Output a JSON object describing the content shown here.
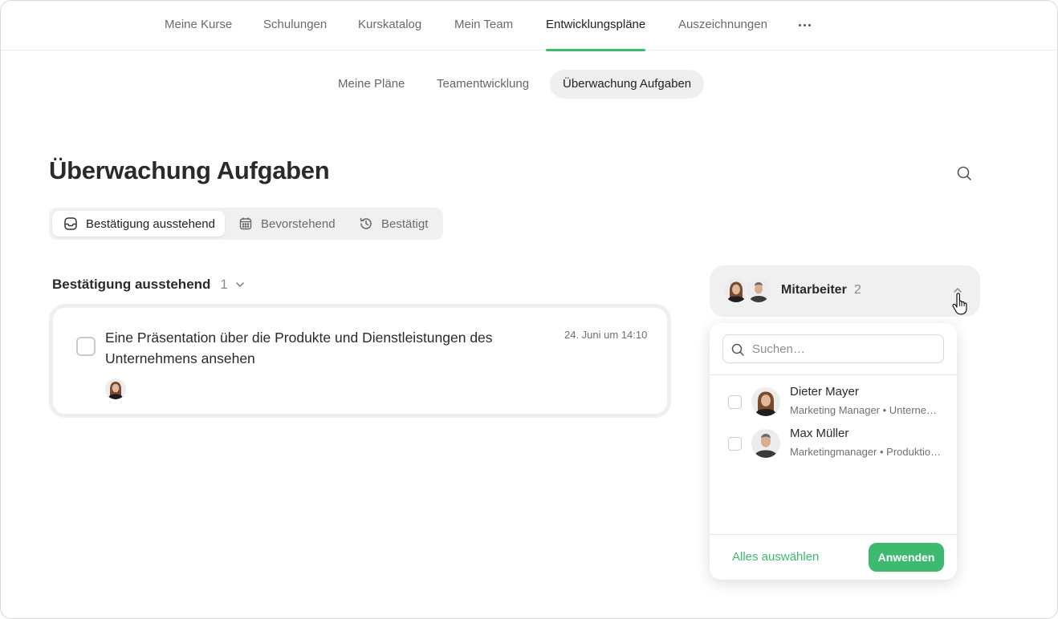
{
  "top_nav": {
    "items": [
      {
        "label": "Meine Kurse"
      },
      {
        "label": "Schulungen"
      },
      {
        "label": "Kurskatalog"
      },
      {
        "label": "Mein Team"
      },
      {
        "label": "Entwicklungspläne",
        "active": true
      },
      {
        "label": "Auszeichnungen"
      }
    ],
    "more_icon": "more-horizontal-icon"
  },
  "sub_nav": {
    "items": [
      {
        "label": "Meine Pläne"
      },
      {
        "label": "Teamentwicklung"
      },
      {
        "label": "Überwachung Aufgaben",
        "active": true
      }
    ]
  },
  "page": {
    "title": "Überwachung Aufgaben",
    "search_icon": "search-icon"
  },
  "status_tabs": [
    {
      "label": "Bestätigung ausstehend",
      "icon": "inbox-icon",
      "active": true
    },
    {
      "label": "Bevorstehend",
      "icon": "calendar-icon"
    },
    {
      "label": "Bestätigt",
      "icon": "history-icon"
    }
  ],
  "section": {
    "title": "Bestätigung ausstehend",
    "count": "1"
  },
  "tasks": [
    {
      "title": "Eine Präsentation über die Produkte und Dienstleistungen des Unternehmens ansehen",
      "date": "24. Juni um 14:10",
      "assignee": "Dieter Mayer"
    }
  ],
  "employee_filter": {
    "label": "Mitarbeiter",
    "count": "2",
    "search_placeholder": "Suchen…",
    "employees": [
      {
        "name": "Dieter Mayer",
        "meta": "Marketing Manager • Unternehmenskommunikation"
      },
      {
        "name": "Max Müller",
        "meta": "Marketingmanager • Produktionsabteilung"
      }
    ],
    "select_all_label": "Alles auswählen",
    "apply_label": "Anwenden"
  },
  "colors": {
    "accent": "#3dba6f",
    "tab_bg": "#f0f0f0"
  }
}
